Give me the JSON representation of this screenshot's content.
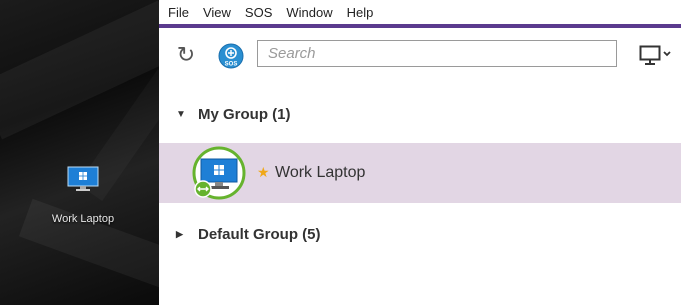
{
  "desktop": {
    "icon_label": "Work Laptop"
  },
  "menu": [
    "File",
    "View",
    "SOS",
    "Window",
    "Help"
  ],
  "toolbar": {
    "search_placeholder": "Search",
    "sos_label": "SOS"
  },
  "groups": [
    {
      "name": "My Group (1)",
      "expanded": true
    },
    {
      "name": "Default Group (5)",
      "expanded": false
    }
  ],
  "device": {
    "name": "Work Laptop",
    "favorite": true
  },
  "colors": {
    "accent": "#5b3a8e",
    "selected_row": "#e2d6e4",
    "star": "#f0a818",
    "status_green": "#66b32e",
    "sos_blue": "#2a8fd1"
  }
}
